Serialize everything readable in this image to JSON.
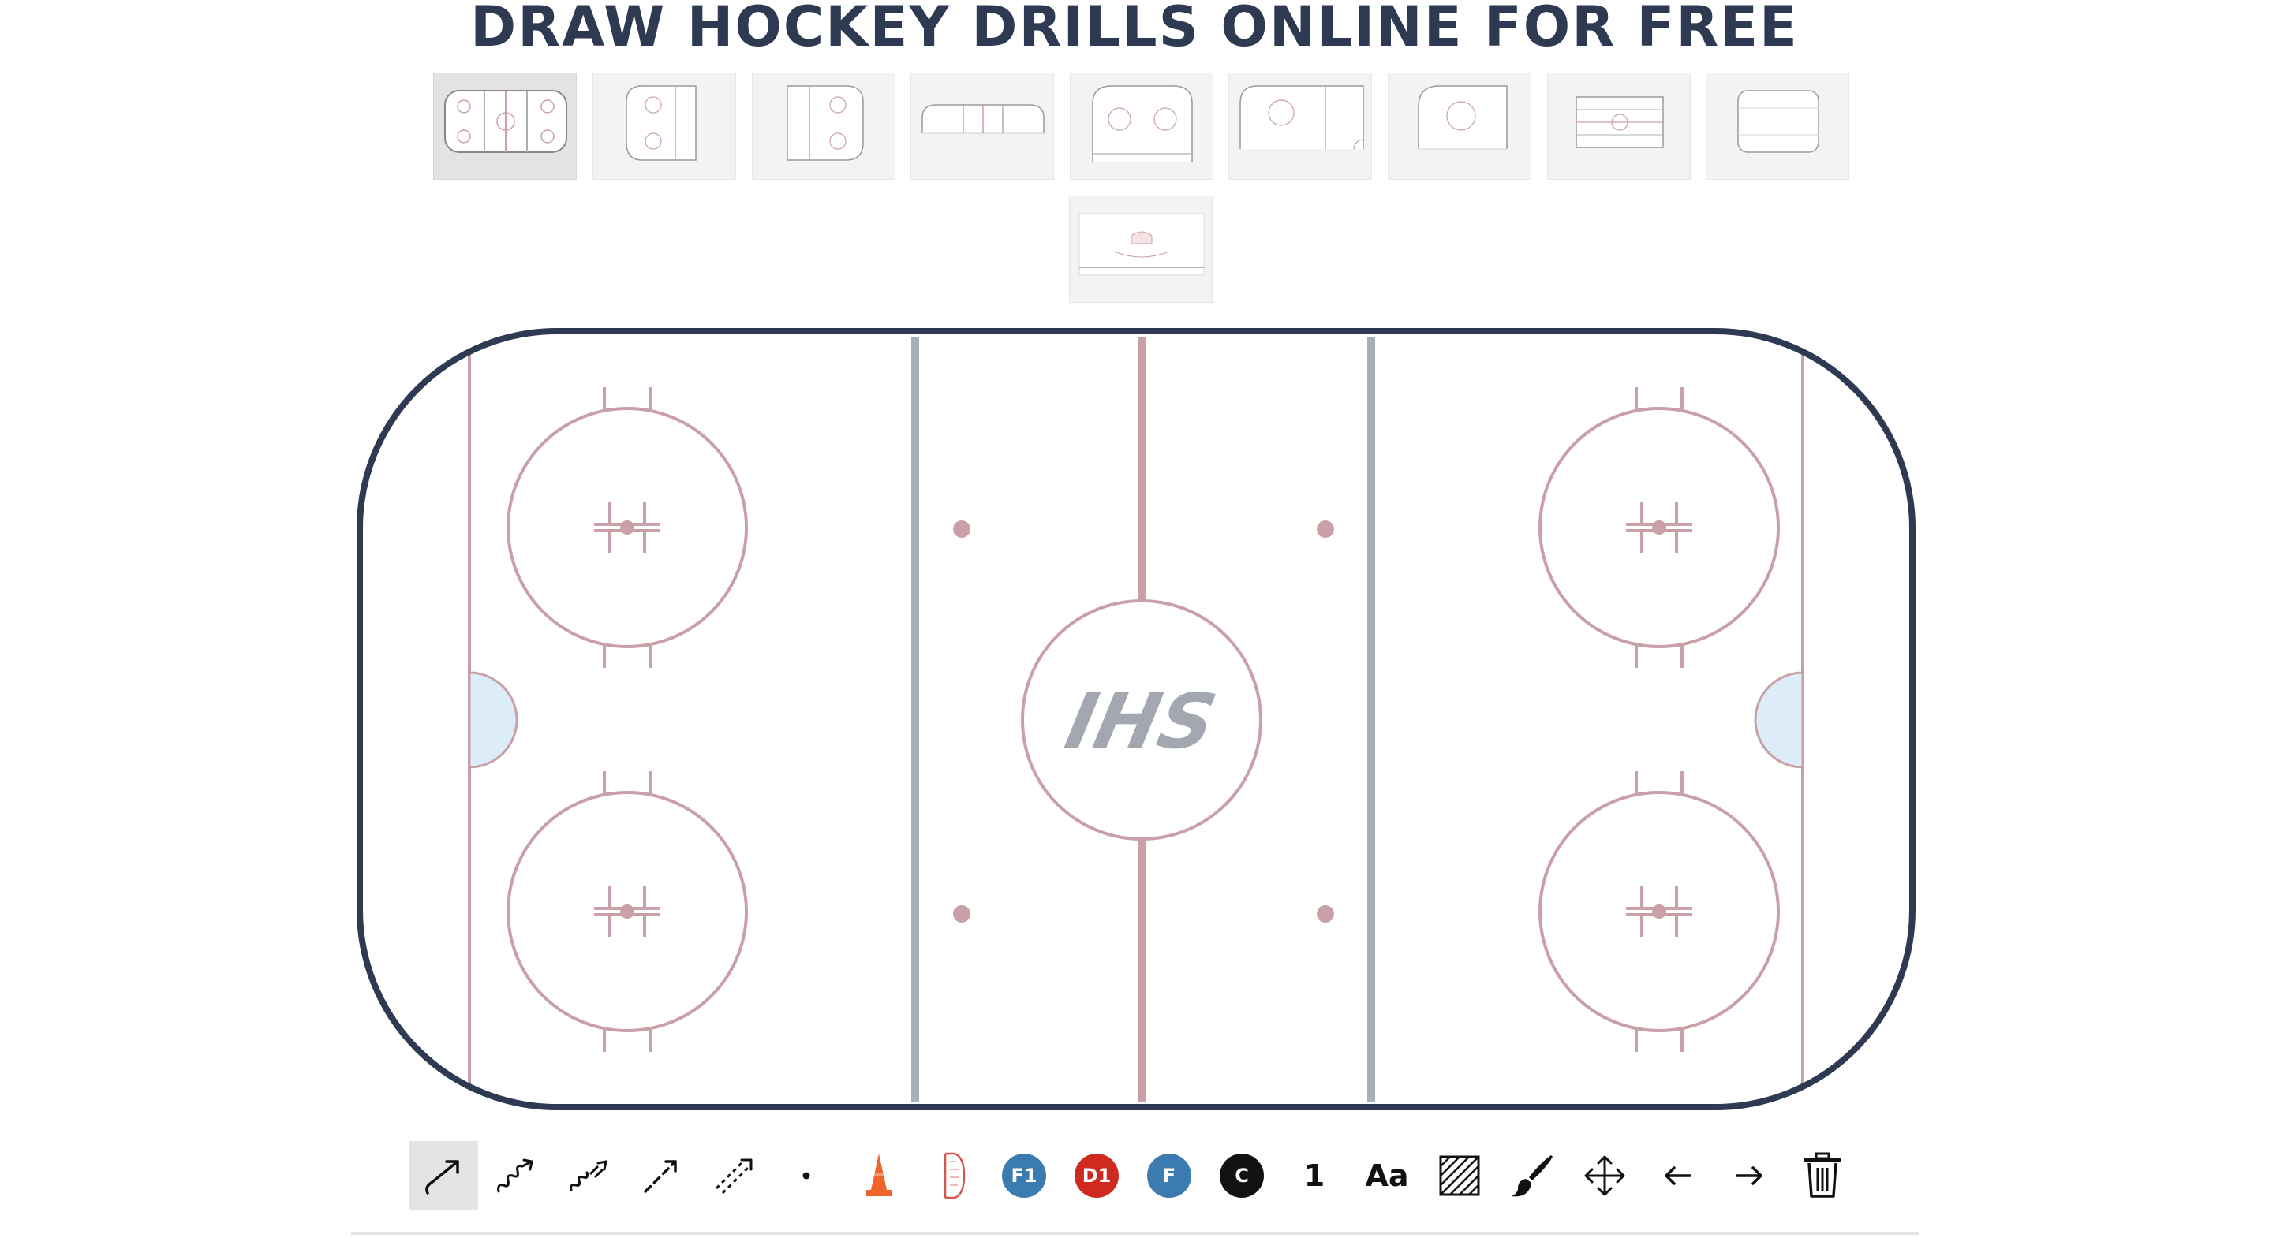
{
  "page": {
    "title": "DRAW HOCKEY DRILLS ONLINE FOR FREE"
  },
  "rink_templates": [
    {
      "name": "full-rink",
      "selected": true
    },
    {
      "name": "half-rink-left",
      "selected": false
    },
    {
      "name": "half-rink-right",
      "selected": false
    },
    {
      "name": "neutral-zone",
      "selected": false
    },
    {
      "name": "end-zone",
      "selected": false
    },
    {
      "name": "quarter-rink",
      "selected": false
    },
    {
      "name": "corner-zone",
      "selected": false
    },
    {
      "name": "blank-rectangle-rink",
      "selected": false
    },
    {
      "name": "blank-rounded-rink",
      "selected": false
    },
    {
      "name": "goal-crease-view",
      "selected": false
    }
  ],
  "rink": {
    "logo_text": "IHS",
    "colors": {
      "boards": "#2e3a52",
      "red_lines": "#c9a0a8",
      "blue_lines": "#a7b0b9",
      "crease": "#dcecf9",
      "logo": "#a3a8b0"
    }
  },
  "toolbar": {
    "tools": [
      {
        "name": "skate-arrow",
        "icon": "curved-arrow-icon",
        "active": true
      },
      {
        "name": "skate-with-puck",
        "icon": "wavy-arrow-icon"
      },
      {
        "name": "backward-skate",
        "icon": "backward-skate-icon"
      },
      {
        "name": "pass",
        "icon": "dashed-arrow-icon"
      },
      {
        "name": "shot",
        "icon": "shot-arrow-icon"
      },
      {
        "name": "puck",
        "icon": "puck-dot-icon"
      },
      {
        "name": "cone",
        "icon": "cone-icon"
      },
      {
        "name": "net",
        "icon": "net-icon"
      },
      {
        "name": "forward-1",
        "label": "F1",
        "color": "#3b7bb0"
      },
      {
        "name": "defense-1",
        "label": "D1",
        "color": "#cf2a1f"
      },
      {
        "name": "forward",
        "label": "F",
        "color": "#3b7bb0"
      },
      {
        "name": "coach",
        "label": "C",
        "color": "#111111"
      },
      {
        "name": "number",
        "label": "1"
      },
      {
        "name": "text",
        "label": "Aa"
      },
      {
        "name": "shaded-area",
        "icon": "hatch-area-icon"
      },
      {
        "name": "freehand",
        "icon": "brush-icon"
      },
      {
        "name": "move",
        "icon": "move-arrows-icon"
      },
      {
        "name": "undo",
        "icon": "arrow-left-icon"
      },
      {
        "name": "redo",
        "icon": "arrow-right-icon"
      },
      {
        "name": "delete",
        "icon": "trash-icon"
      }
    ]
  }
}
